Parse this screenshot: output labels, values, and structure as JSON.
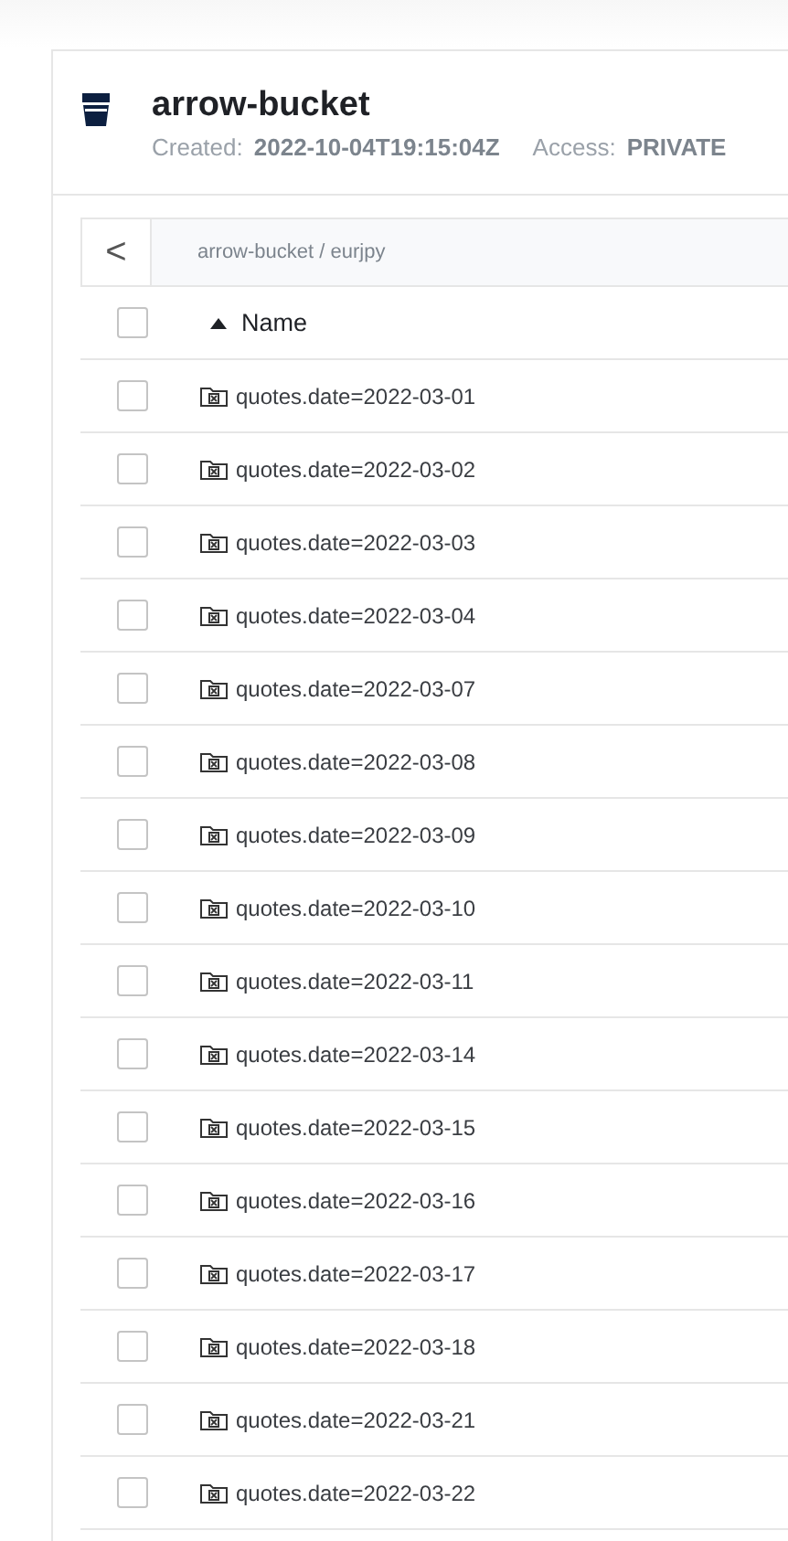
{
  "bucket": {
    "name": "arrow-bucket",
    "created_label": "Created:",
    "created": "2022-10-04T19:15:04Z",
    "access_label": "Access:",
    "access": "PRIVATE"
  },
  "breadcrumb": {
    "back": "<",
    "path": "arrow-bucket / eurjpy"
  },
  "table": {
    "header": {
      "label": "Name",
      "sorted_ascending": true,
      "checked": false
    },
    "rows": [
      {
        "name": "quotes.date=2022-03-01",
        "checked": false
      },
      {
        "name": "quotes.date=2022-03-02",
        "checked": false
      },
      {
        "name": "quotes.date=2022-03-03",
        "checked": false
      },
      {
        "name": "quotes.date=2022-03-04",
        "checked": false
      },
      {
        "name": "quotes.date=2022-03-07",
        "checked": false
      },
      {
        "name": "quotes.date=2022-03-08",
        "checked": false
      },
      {
        "name": "quotes.date=2022-03-09",
        "checked": false
      },
      {
        "name": "quotes.date=2022-03-10",
        "checked": false
      },
      {
        "name": "quotes.date=2022-03-11",
        "checked": false
      },
      {
        "name": "quotes.date=2022-03-14",
        "checked": false
      },
      {
        "name": "quotes.date=2022-03-15",
        "checked": false
      },
      {
        "name": "quotes.date=2022-03-16",
        "checked": false
      },
      {
        "name": "quotes.date=2022-03-17",
        "checked": false
      },
      {
        "name": "quotes.date=2022-03-18",
        "checked": false
      },
      {
        "name": "quotes.date=2022-03-21",
        "checked": false
      },
      {
        "name": "quotes.date=2022-03-22",
        "checked": false
      }
    ]
  }
}
